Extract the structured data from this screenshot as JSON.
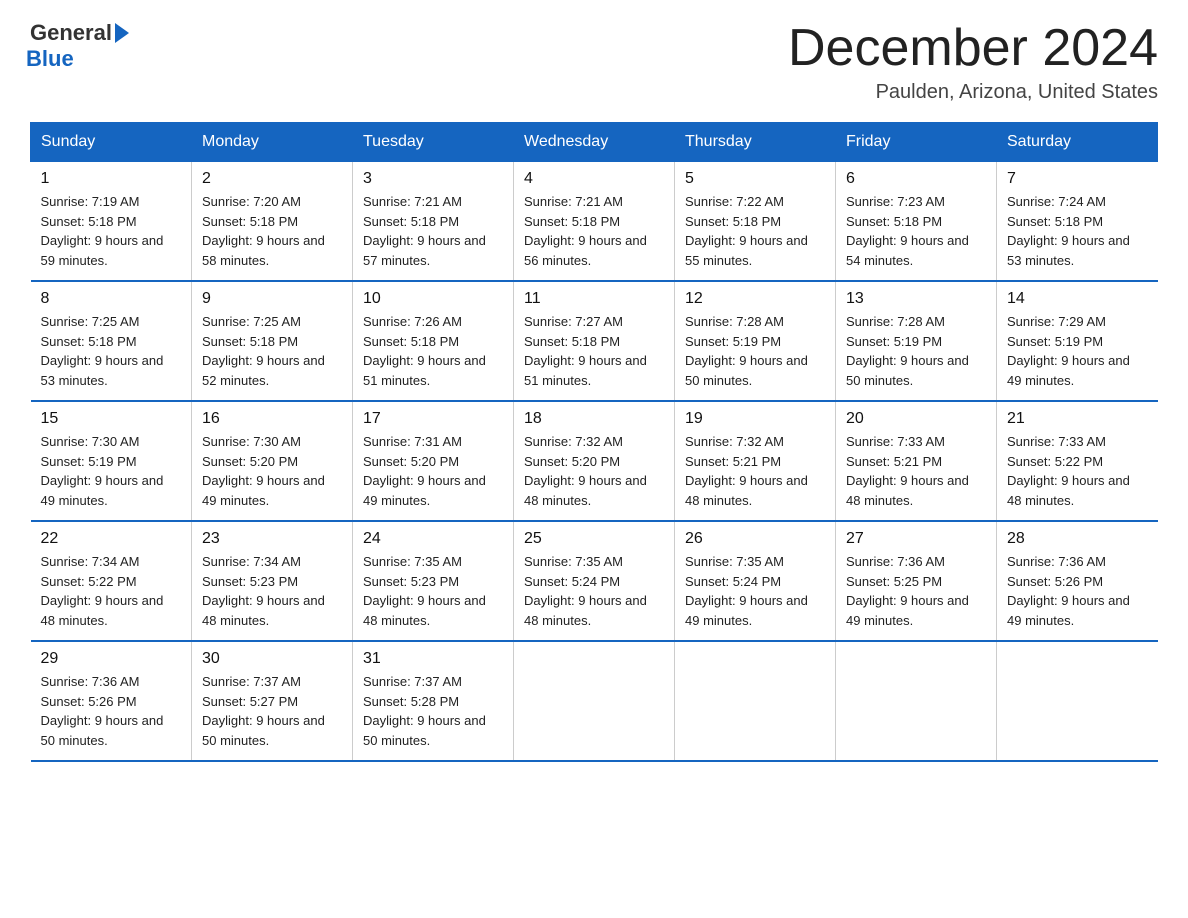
{
  "header": {
    "logo_general": "General",
    "logo_blue": "Blue",
    "month_title": "December 2024",
    "location": "Paulden, Arizona, United States"
  },
  "days_of_week": [
    "Sunday",
    "Monday",
    "Tuesday",
    "Wednesday",
    "Thursday",
    "Friday",
    "Saturday"
  ],
  "weeks": [
    [
      {
        "num": "1",
        "sunrise": "7:19 AM",
        "sunset": "5:18 PM",
        "daylight": "9 hours and 59 minutes."
      },
      {
        "num": "2",
        "sunrise": "7:20 AM",
        "sunset": "5:18 PM",
        "daylight": "9 hours and 58 minutes."
      },
      {
        "num": "3",
        "sunrise": "7:21 AM",
        "sunset": "5:18 PM",
        "daylight": "9 hours and 57 minutes."
      },
      {
        "num": "4",
        "sunrise": "7:21 AM",
        "sunset": "5:18 PM",
        "daylight": "9 hours and 56 minutes."
      },
      {
        "num": "5",
        "sunrise": "7:22 AM",
        "sunset": "5:18 PM",
        "daylight": "9 hours and 55 minutes."
      },
      {
        "num": "6",
        "sunrise": "7:23 AM",
        "sunset": "5:18 PM",
        "daylight": "9 hours and 54 minutes."
      },
      {
        "num": "7",
        "sunrise": "7:24 AM",
        "sunset": "5:18 PM",
        "daylight": "9 hours and 53 minutes."
      }
    ],
    [
      {
        "num": "8",
        "sunrise": "7:25 AM",
        "sunset": "5:18 PM",
        "daylight": "9 hours and 53 minutes."
      },
      {
        "num": "9",
        "sunrise": "7:25 AM",
        "sunset": "5:18 PM",
        "daylight": "9 hours and 52 minutes."
      },
      {
        "num": "10",
        "sunrise": "7:26 AM",
        "sunset": "5:18 PM",
        "daylight": "9 hours and 51 minutes."
      },
      {
        "num": "11",
        "sunrise": "7:27 AM",
        "sunset": "5:18 PM",
        "daylight": "9 hours and 51 minutes."
      },
      {
        "num": "12",
        "sunrise": "7:28 AM",
        "sunset": "5:19 PM",
        "daylight": "9 hours and 50 minutes."
      },
      {
        "num": "13",
        "sunrise": "7:28 AM",
        "sunset": "5:19 PM",
        "daylight": "9 hours and 50 minutes."
      },
      {
        "num": "14",
        "sunrise": "7:29 AM",
        "sunset": "5:19 PM",
        "daylight": "9 hours and 49 minutes."
      }
    ],
    [
      {
        "num": "15",
        "sunrise": "7:30 AM",
        "sunset": "5:19 PM",
        "daylight": "9 hours and 49 minutes."
      },
      {
        "num": "16",
        "sunrise": "7:30 AM",
        "sunset": "5:20 PM",
        "daylight": "9 hours and 49 minutes."
      },
      {
        "num": "17",
        "sunrise": "7:31 AM",
        "sunset": "5:20 PM",
        "daylight": "9 hours and 49 minutes."
      },
      {
        "num": "18",
        "sunrise": "7:32 AM",
        "sunset": "5:20 PM",
        "daylight": "9 hours and 48 minutes."
      },
      {
        "num": "19",
        "sunrise": "7:32 AM",
        "sunset": "5:21 PM",
        "daylight": "9 hours and 48 minutes."
      },
      {
        "num": "20",
        "sunrise": "7:33 AM",
        "sunset": "5:21 PM",
        "daylight": "9 hours and 48 minutes."
      },
      {
        "num": "21",
        "sunrise": "7:33 AM",
        "sunset": "5:22 PM",
        "daylight": "9 hours and 48 minutes."
      }
    ],
    [
      {
        "num": "22",
        "sunrise": "7:34 AM",
        "sunset": "5:22 PM",
        "daylight": "9 hours and 48 minutes."
      },
      {
        "num": "23",
        "sunrise": "7:34 AM",
        "sunset": "5:23 PM",
        "daylight": "9 hours and 48 minutes."
      },
      {
        "num": "24",
        "sunrise": "7:35 AM",
        "sunset": "5:23 PM",
        "daylight": "9 hours and 48 minutes."
      },
      {
        "num": "25",
        "sunrise": "7:35 AM",
        "sunset": "5:24 PM",
        "daylight": "9 hours and 48 minutes."
      },
      {
        "num": "26",
        "sunrise": "7:35 AM",
        "sunset": "5:24 PM",
        "daylight": "9 hours and 49 minutes."
      },
      {
        "num": "27",
        "sunrise": "7:36 AM",
        "sunset": "5:25 PM",
        "daylight": "9 hours and 49 minutes."
      },
      {
        "num": "28",
        "sunrise": "7:36 AM",
        "sunset": "5:26 PM",
        "daylight": "9 hours and 49 minutes."
      }
    ],
    [
      {
        "num": "29",
        "sunrise": "7:36 AM",
        "sunset": "5:26 PM",
        "daylight": "9 hours and 50 minutes."
      },
      {
        "num": "30",
        "sunrise": "7:37 AM",
        "sunset": "5:27 PM",
        "daylight": "9 hours and 50 minutes."
      },
      {
        "num": "31",
        "sunrise": "7:37 AM",
        "sunset": "5:28 PM",
        "daylight": "9 hours and 50 minutes."
      },
      null,
      null,
      null,
      null
    ]
  ]
}
